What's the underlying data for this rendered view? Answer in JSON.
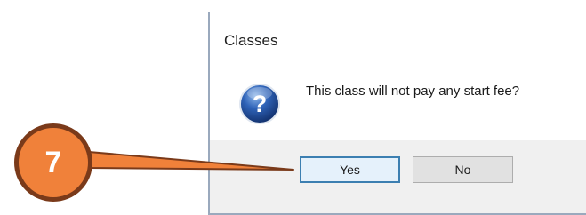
{
  "dialog": {
    "title": "Classes",
    "message": "This class will not pay any start fee?",
    "icon": "question-icon",
    "buttons": {
      "yes_label": "Yes",
      "no_label": "No"
    }
  },
  "callout": {
    "number": "7",
    "color": "#f0813a",
    "outline_color": "#7a3a1a"
  }
}
